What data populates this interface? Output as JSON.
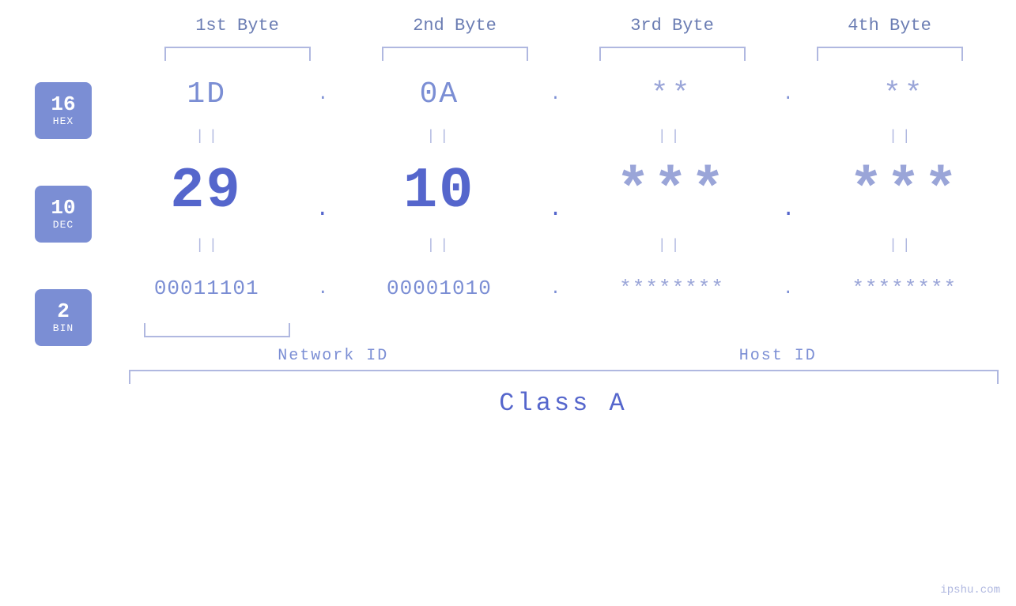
{
  "header": {
    "byte1": "1st Byte",
    "byte2": "2nd Byte",
    "byte3": "3rd Byte",
    "byte4": "4th Byte"
  },
  "badges": {
    "hex": {
      "number": "16",
      "label": "HEX"
    },
    "dec": {
      "number": "10",
      "label": "DEC"
    },
    "bin": {
      "number": "2",
      "label": "BIN"
    }
  },
  "rows": {
    "hex": {
      "b1": "1D",
      "b2": "0A",
      "b3": "**",
      "b4": "**"
    },
    "dec": {
      "b1": "29",
      "b2": "10",
      "b3": "***",
      "b4": "***"
    },
    "bin": {
      "b1": "00011101",
      "b2": "00001010",
      "b3": "********",
      "b4": "********"
    }
  },
  "labels": {
    "network_id": "Network ID",
    "host_id": "Host ID",
    "class": "Class A"
  },
  "watermark": "ipshu.com"
}
